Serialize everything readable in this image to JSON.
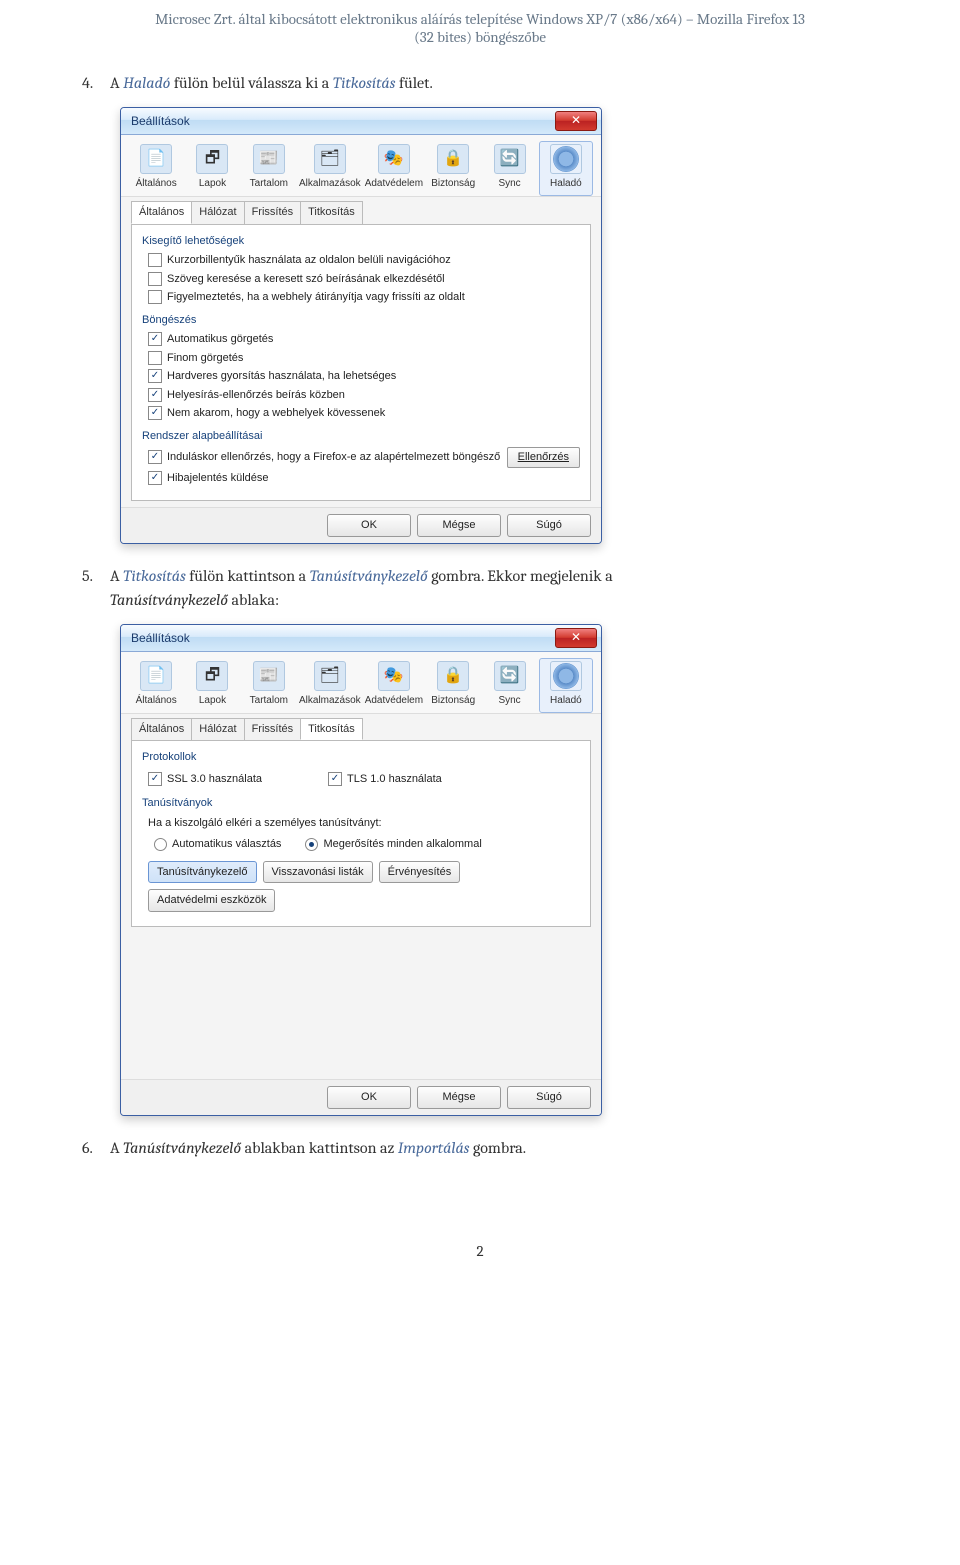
{
  "header": {
    "line1": "Microsec Zrt. által kibocsátott elektronikus aláírás telepítése Windows XP/7 (x86/x64) – Mozilla Firefox 13",
    "line2": "(32 bites) böngészőbe"
  },
  "steps": {
    "s4": {
      "num": "4.",
      "t1": "A ",
      "hilado": "Haladó",
      "t2": " fülön belül válassza ki a ",
      "titk": "Titkosítás",
      "t3": " fület."
    },
    "s5": {
      "num": "5.",
      "t1": "A ",
      "titk": "Titkosítás",
      "t2": " fülön kattintson a ",
      "tanu": "Tanúsítványkezelő",
      "t3": " gombra. Ekkor megjelenik a ",
      "tanu2": "Tanúsítványkezelő",
      "t4": " ablaka:"
    },
    "s6": {
      "num": "6.",
      "t1": "A ",
      "tanu": "Tanúsítványkezelő",
      "t2": " ablakban kattintson az ",
      "imp": "Importálás",
      "t3": " gombra."
    }
  },
  "dlg1": {
    "title": "Beállítások",
    "tabs": [
      "Általános",
      "Lapok",
      "Tartalom",
      "Alkalmazások",
      "Adatvédelem",
      "Biztonság",
      "Sync",
      "Haladó"
    ],
    "activeTab": 7,
    "subtabs": [
      "Általános",
      "Hálózat",
      "Frissítés",
      "Titkosítás"
    ],
    "activeSub": 0,
    "groups": {
      "kisegito": {
        "title": "Kisegítő lehetőségek",
        "items": [
          {
            "checked": false,
            "label": "Kurzorbillentyűk használata az oldalon belüli navigációhoz"
          },
          {
            "checked": false,
            "label": "Szöveg keresése a keresett szó beírásának elkezdésétől"
          },
          {
            "checked": false,
            "label": "Figyelmeztetés, ha a webhely átirányítja vagy frissíti az oldalt"
          }
        ]
      },
      "bongeszes": {
        "title": "Böngészés",
        "items": [
          {
            "checked": true,
            "label": "Automatikus görgetés",
            "u": "A"
          },
          {
            "checked": false,
            "label": "Finom görgetés",
            "u": "F"
          },
          {
            "checked": true,
            "label": "Hardveres gyorsítás használata, ha lehetséges",
            "u": "H"
          },
          {
            "checked": true,
            "label": "Helyesírás-ellenőrzés beírás közben",
            "u": "H"
          },
          {
            "checked": true,
            "label": "Nem akarom, hogy a webhelyek kövessenek",
            "u": "N"
          }
        ]
      },
      "rendszer": {
        "title": "Rendszer alapbeállításai",
        "items": [
          {
            "checked": true,
            "label": "Induláskor ellenőrzés, hogy a Firefox-e az alapértelmezett böngésző",
            "u": "I"
          },
          {
            "checked": true,
            "label": "Hibajelentés küldése",
            "u": "H"
          }
        ],
        "checkbtn": "Ellenőrzés"
      }
    },
    "buttons": [
      "OK",
      "Mégse",
      "Súgó"
    ]
  },
  "dlg2": {
    "title": "Beállítások",
    "tabs": [
      "Általános",
      "Lapok",
      "Tartalom",
      "Alkalmazások",
      "Adatvédelem",
      "Biztonság",
      "Sync",
      "Haladó"
    ],
    "activeTab": 7,
    "subtabs": [
      "Általános",
      "Hálózat",
      "Frissítés",
      "Titkosítás"
    ],
    "activeSub": 3,
    "protokollok": {
      "title": "Protokollok",
      "ssl": {
        "checked": true,
        "label": "SSL 3.0 használata"
      },
      "tls": {
        "checked": true,
        "label": "TLS 1.0 használata"
      }
    },
    "tanusitvanyok": {
      "title": "Tanúsítványok",
      "prompt": "Ha a kiszolgáló elkéri a személyes tanúsítványt:",
      "radio": [
        {
          "sel": false,
          "label": "Automatikus választás"
        },
        {
          "sel": true,
          "label": "Megerősítés minden alkalommal"
        }
      ],
      "btns": [
        "Tanúsítványkezelő",
        "Visszavonási listák",
        "Érvényesítés",
        "Adatvédelmi eszközök"
      ]
    },
    "buttons": [
      "OK",
      "Mégse",
      "Súgó"
    ]
  },
  "icons": [
    "📄",
    "🗗",
    "📰",
    "🗂",
    "🎭",
    "🔒",
    "🔄",
    "⚙"
  ],
  "pageNumber": "2"
}
